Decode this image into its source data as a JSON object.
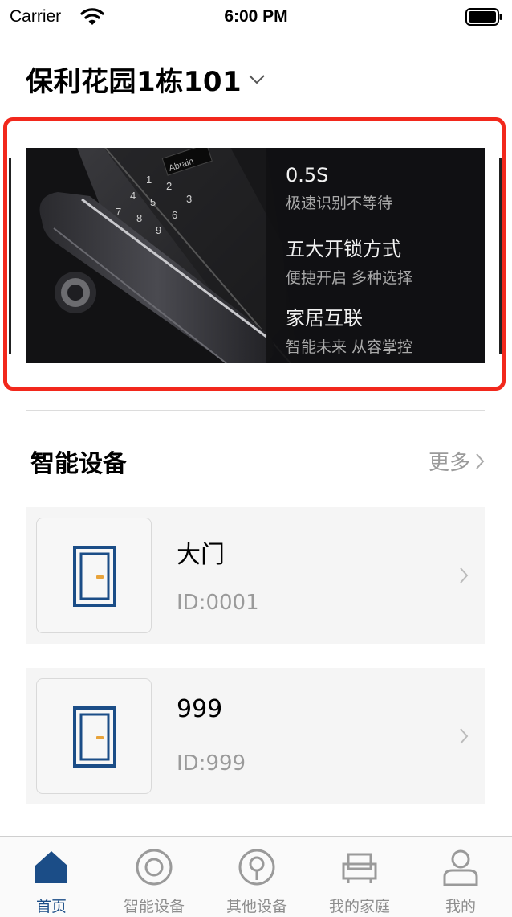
{
  "status_bar": {
    "carrier": "Carrier",
    "time": "6:00 PM"
  },
  "header": {
    "home_name": "保利花园1栋101"
  },
  "banner": {
    "lock_brand": "Abrain",
    "features": [
      {
        "title": "0.5S",
        "subtitle": "极速识别不等待"
      },
      {
        "title": "五大开锁方式",
        "subtitle": "便捷开启 多种选择"
      },
      {
        "title": "家居互联",
        "subtitle": "智能未来 从容掌控"
      }
    ]
  },
  "section": {
    "title": "智能设备",
    "more_label": "更多"
  },
  "devices": [
    {
      "name": "大门",
      "id_text": "ID:0001"
    },
    {
      "name": "999",
      "id_text": "ID:999"
    }
  ],
  "tabs": [
    {
      "label": "首页",
      "icon": "home-icon",
      "active": true
    },
    {
      "label": "智能设备",
      "icon": "smart-device-icon",
      "active": false
    },
    {
      "label": "其他设备",
      "icon": "other-device-icon",
      "active": false
    },
    {
      "label": "我的家庭",
      "icon": "family-icon",
      "active": false
    },
    {
      "label": "我的",
      "icon": "profile-icon",
      "active": false
    }
  ],
  "colors": {
    "accent": "#1b4d87",
    "banner_border": "#f2281c",
    "door_blue": "#1b4d87",
    "door_handle": "#e8a33b"
  }
}
